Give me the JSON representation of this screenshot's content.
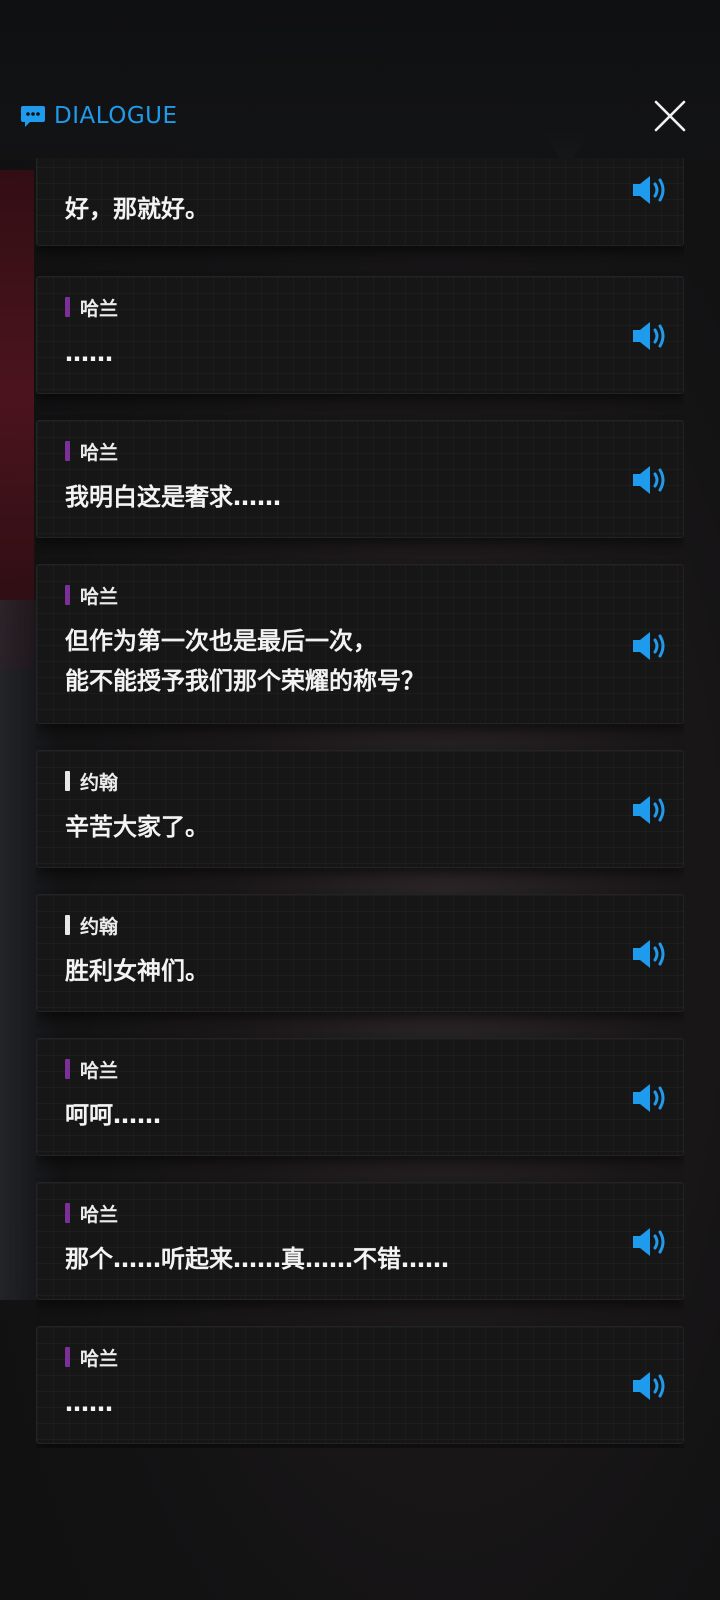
{
  "header": {
    "title": "DIALOGUE",
    "accent_color": "#1e9bec",
    "icon": "chat-bubble-icon",
    "close_icon": "close-icon"
  },
  "dialogue": [
    {
      "speaker": "",
      "speaker_color": "",
      "text": "好，那就好。",
      "voice_icon": "speaker-icon"
    },
    {
      "speaker": "哈兰",
      "speaker_color": "#7b2f99",
      "text": "……",
      "voice_icon": "speaker-icon"
    },
    {
      "speaker": "哈兰",
      "speaker_color": "#7b2f99",
      "text": "我明白这是奢求……",
      "voice_icon": "speaker-icon"
    },
    {
      "speaker": "哈兰",
      "speaker_color": "#7b2f99",
      "text": "但作为第一次也是最后一次，\n能不能授予我们那个荣耀的称号？",
      "voice_icon": "speaker-icon"
    },
    {
      "speaker": "约翰",
      "speaker_color": "#e8e8e8",
      "text": "辛苦大家了。",
      "voice_icon": "speaker-icon"
    },
    {
      "speaker": "约翰",
      "speaker_color": "#e8e8e8",
      "text": "胜利女神们。",
      "voice_icon": "speaker-icon"
    },
    {
      "speaker": "哈兰",
      "speaker_color": "#7b2f99",
      "text": "呵呵……",
      "voice_icon": "speaker-icon"
    },
    {
      "speaker": "哈兰",
      "speaker_color": "#7b2f99",
      "text": "那个……听起来……真……不错……",
      "voice_icon": "speaker-icon"
    },
    {
      "speaker": "哈兰",
      "speaker_color": "#7b2f99",
      "text": "……",
      "voice_icon": "speaker-icon"
    }
  ]
}
